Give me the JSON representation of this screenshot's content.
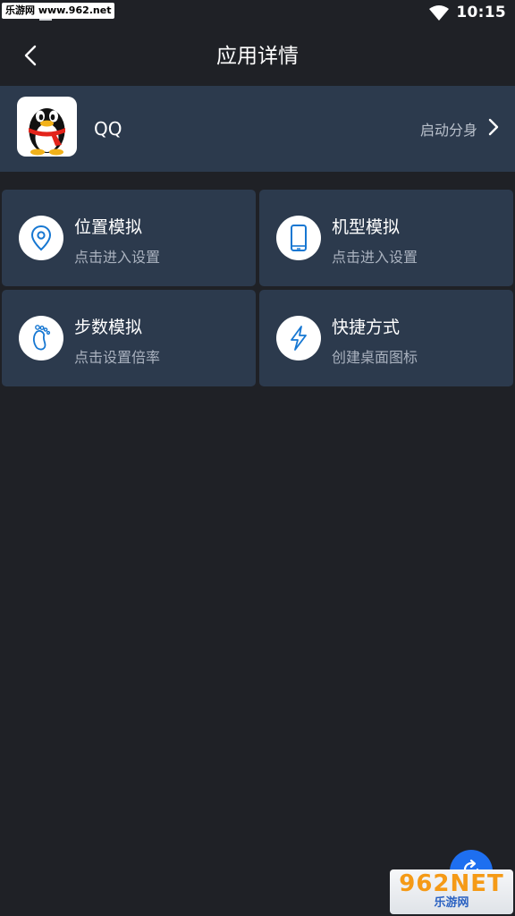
{
  "status_bar": {
    "watermark": "乐游网 www.962.net",
    "time": "10:15"
  },
  "toolbar": {
    "title": "应用详情"
  },
  "app": {
    "name": "QQ",
    "launch_clone_label": "启动分身"
  },
  "features": [
    {
      "title": "位置模拟",
      "subtitle": "点击进入设置",
      "icon": "location-pin-icon"
    },
    {
      "title": "机型模拟",
      "subtitle": "点击进入设置",
      "icon": "phone-icon"
    },
    {
      "title": "步数模拟",
      "subtitle": "点击设置倍率",
      "icon": "footprint-icon"
    },
    {
      "title": "快捷方式",
      "subtitle": "创建桌面图标",
      "icon": "lightning-icon"
    }
  ],
  "watermark_corner": {
    "brand": "962NET",
    "subtitle": "乐游网"
  },
  "colors": {
    "background": "#1f2126",
    "card": "#2c3a4d",
    "icon_accent": "#1677d2",
    "fab": "#1e6ff0"
  }
}
